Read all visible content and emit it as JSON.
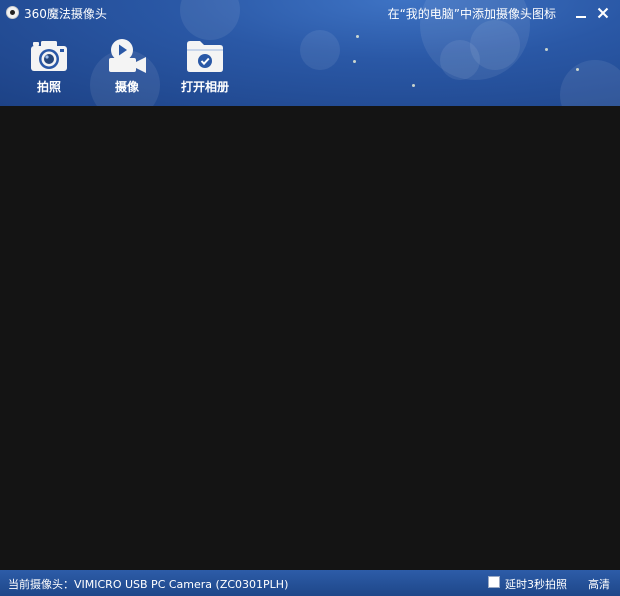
{
  "window": {
    "title": "360魔法摄像头",
    "add_shortcut_text": "在“我的电脑”中添加摄像头图标",
    "minimize_icon": "minimize-icon",
    "close_icon": "close-icon"
  },
  "toolbar": {
    "items": [
      {
        "label": "拍照",
        "icon": "camera-icon"
      },
      {
        "label": "摄像",
        "icon": "video-camera-icon"
      },
      {
        "label": "打开相册",
        "icon": "folder-check-icon"
      }
    ]
  },
  "statusbar": {
    "current_camera": "当前摄像头：VIMICRO USB PC Camera (ZC0301PLH)",
    "delay_option_label": "延时3秒拍照",
    "delay_option_checked": false,
    "quality_label": "高清"
  },
  "colors": {
    "header_background": "#2a58a6",
    "camera_view_background": "#141414",
    "statusbar_background": "#2d5ca8",
    "text": "#ffffff"
  }
}
